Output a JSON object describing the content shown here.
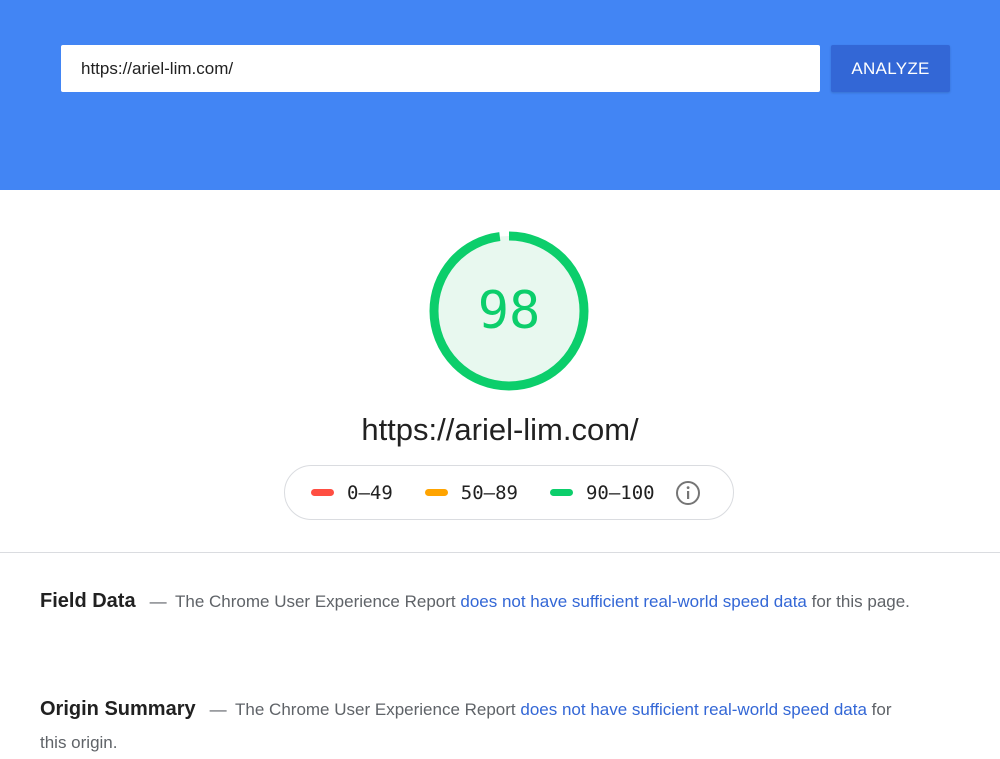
{
  "search": {
    "url_value": "https://ariel-lim.com/",
    "analyze_label": "ANALYZE"
  },
  "result": {
    "score": "98",
    "score_value": 98,
    "tested_url": "https://ariel-lim.com/"
  },
  "legend": {
    "items": [
      {
        "range": "0–49",
        "color": "#ff4e42"
      },
      {
        "range": "50–89",
        "color": "#ffa400"
      },
      {
        "range": "90–100",
        "color": "#0cce6b"
      }
    ],
    "info_icon": "info-icon"
  },
  "colors": {
    "header_bg": "#4285f4",
    "button_bg": "#3367d6",
    "score_fast": "#0cce6b",
    "score_fast_fill": "#e8f8ef",
    "link": "#3367d6"
  },
  "field_data": {
    "title": "Field Data",
    "dash": "—",
    "text_before": "The Chrome User Experience Report",
    "link_text": "does not have sufficient real-world speed data",
    "text_after": "for this page."
  },
  "origin_summary": {
    "title": "Origin Summary",
    "dash": "—",
    "text_before": "The Chrome User Experience Report",
    "link_text": "does not have sufficient real-world speed data",
    "text_after": "for this origin."
  }
}
